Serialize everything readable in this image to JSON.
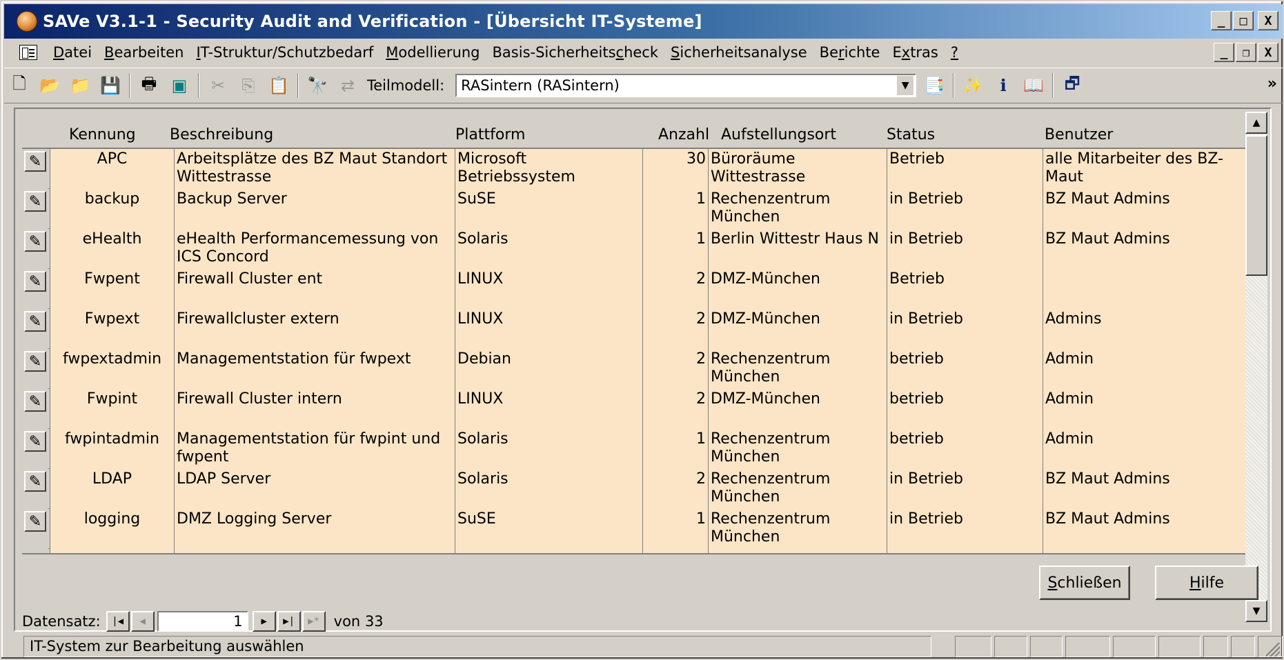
{
  "window": {
    "title": "SAVe V3.1-1 - Security Audit and Verification - [Übersicht IT-Systeme]",
    "caption_minimize": "_",
    "caption_maximize": "□",
    "caption_close": "X"
  },
  "menu": {
    "items": [
      {
        "pre": "",
        "key": "D",
        "post": "atei"
      },
      {
        "pre": "",
        "key": "B",
        "post": "earbeiten"
      },
      {
        "pre": "",
        "key": "I",
        "post": "T-Struktur/Schutzbedarf"
      },
      {
        "pre": "",
        "key": "M",
        "post": "odellierung"
      },
      {
        "pre": "Basis-Sicherheits",
        "key": "c",
        "post": "heck"
      },
      {
        "pre": "",
        "key": "S",
        "post": "icherheitsanalyse"
      },
      {
        "pre": "Be",
        "key": "r",
        "post": "ichte"
      },
      {
        "pre": "E",
        "key": "x",
        "post": "tras"
      },
      {
        "pre": "",
        "key": "?",
        "post": ""
      }
    ]
  },
  "toolbar": {
    "teilmodell_label": "Teilmodell:",
    "teilmodell_value": "RASintern (RASintern)",
    "more": "»"
  },
  "grid": {
    "columns": [
      "Kennung",
      "Beschreibung",
      "Plattform",
      "Anzahl",
      "Aufstellungsort",
      "Status",
      "Benutzer"
    ],
    "rows": [
      {
        "kennung": "APC",
        "beschreibung": "Arbeitsplätze des BZ Maut Standort Wittestrasse",
        "plattform": "Microsoft Betriebssystem",
        "anzahl": "30",
        "ort": "Büroräume Wittestrasse",
        "status": "Betrieb",
        "benutzer": "alle Mitarbeiter des BZ-Maut"
      },
      {
        "kennung": "backup",
        "beschreibung": "Backup Server",
        "plattform": "SuSE",
        "anzahl": "1",
        "ort": "Rechenzentrum München",
        "status": "in Betrieb",
        "benutzer": "BZ Maut Admins"
      },
      {
        "kennung": "eHealth",
        "beschreibung": "eHealth Performancemessung von ICS Concord",
        "plattform": "Solaris",
        "anzahl": "1",
        "ort": "Berlin Wittestr Haus N",
        "status": "in Betrieb",
        "benutzer": "BZ Maut Admins"
      },
      {
        "kennung": "Fwpent",
        "beschreibung": "Firewall Cluster ent",
        "plattform": "LINUX",
        "anzahl": "2",
        "ort": "DMZ-München",
        "status": "Betrieb",
        "benutzer": ""
      },
      {
        "kennung": "Fwpext",
        "beschreibung": "Firewallcluster extern",
        "plattform": "LINUX",
        "anzahl": "2",
        "ort": "DMZ-München",
        "status": "in Betrieb",
        "benutzer": "Admins"
      },
      {
        "kennung": "fwpextadmin",
        "beschreibung": "Managementstation für fwpext",
        "plattform": "Debian",
        "anzahl": "2",
        "ort": "Rechenzentrum München",
        "status": "betrieb",
        "benutzer": "Admin"
      },
      {
        "kennung": "Fwpint",
        "beschreibung": "Firewall Cluster intern",
        "plattform": "LINUX",
        "anzahl": "2",
        "ort": "DMZ-München",
        "status": "betrieb",
        "benutzer": "Admin"
      },
      {
        "kennung": "fwpintadmin",
        "beschreibung": "Managementstation für fwpint und fwpent",
        "plattform": "Solaris",
        "anzahl": "1",
        "ort": "Rechenzentrum München",
        "status": "betrieb",
        "benutzer": "Admin"
      },
      {
        "kennung": "LDAP",
        "beschreibung": "LDAP Server",
        "plattform": "Solaris",
        "anzahl": "2",
        "ort": "Rechenzentrum München",
        "status": "in Betrieb",
        "benutzer": "BZ Maut Admins"
      },
      {
        "kennung": "logging",
        "beschreibung": "DMZ Logging Server",
        "plattform": "SuSE",
        "anzahl": "1",
        "ort": "Rechenzentrum München",
        "status": "in Betrieb",
        "benutzer": "BZ Maut Admins"
      }
    ]
  },
  "buttons": {
    "close_pre": "",
    "close_key": "S",
    "close_post": "chließen",
    "help_pre": "",
    "help_key": "H",
    "help_post": "ilfe"
  },
  "navigator": {
    "label": "Datensatz:",
    "current": "1",
    "of_label": "von",
    "total": "33"
  },
  "statusbar": {
    "text": "IT-System zur Bearbeitung auswählen"
  },
  "colors": {
    "title_gradient_start": "#0a246a",
    "title_gradient_end": "#a6caf0",
    "row_background": "#fbe5c6",
    "chrome": "#d4d0c8"
  },
  "icons": {
    "app": "save-app-icon",
    "row_edit": "pencil-icon"
  }
}
